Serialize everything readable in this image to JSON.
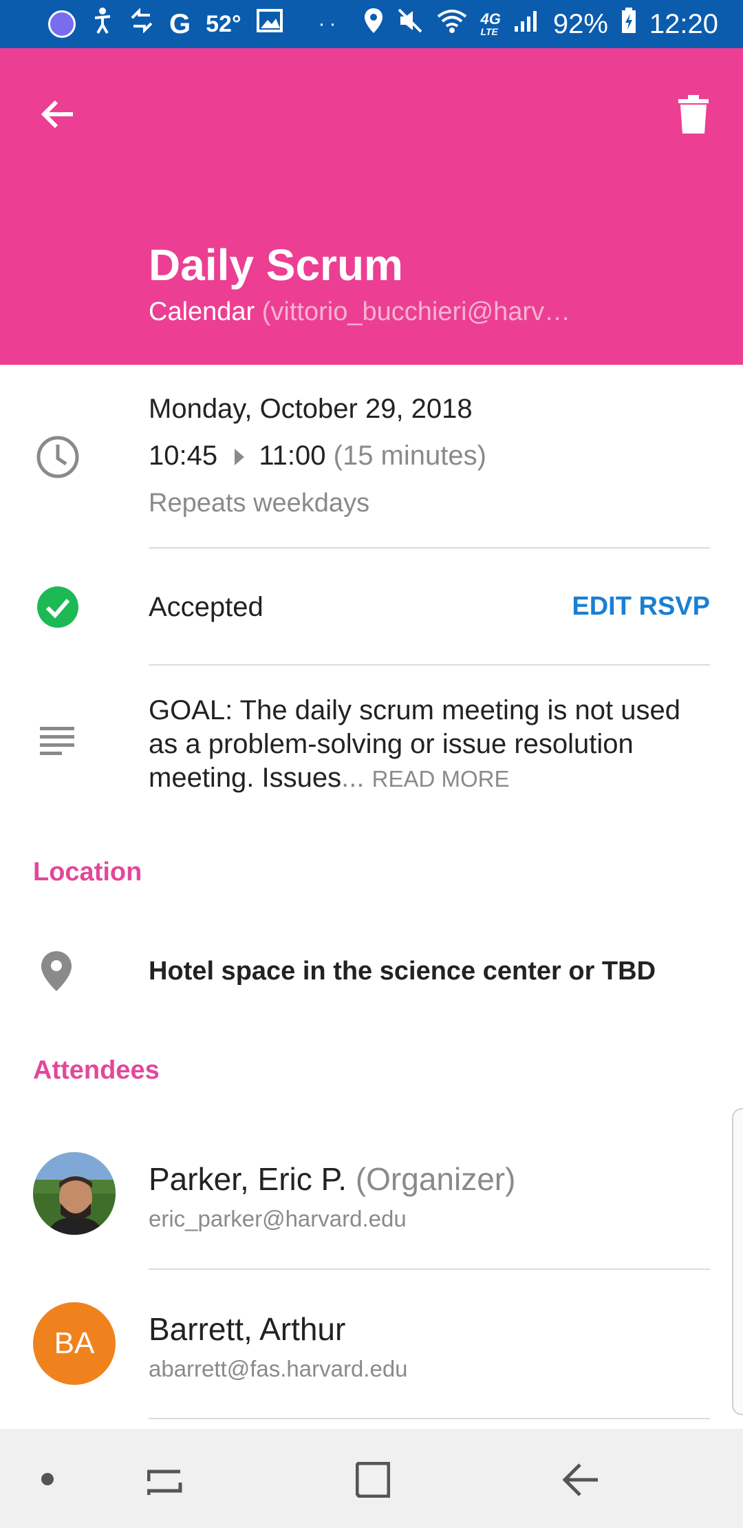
{
  "status_bar": {
    "temperature": "52°",
    "g_letter": "G",
    "network": "4G",
    "network_sub": "LTE",
    "battery": "92%",
    "time": "12:20"
  },
  "header": {
    "title": "Daily Scrum",
    "calendar_label": "Calendar",
    "calendar_account": "(vittorio_bucchieri@harv…"
  },
  "event": {
    "date": "Monday, October 29, 2018",
    "start": "10:45",
    "end": "11:00",
    "duration": "(15 minutes)",
    "recurrence": "Repeats weekdays"
  },
  "rsvp": {
    "status": "Accepted",
    "edit_label": "EDIT RSVP"
  },
  "description": {
    "text": "GOAL:   The daily scrum meeting is not used as a problem-solving or issue resolution meeting. Issues",
    "ellipsis": "...",
    "read_more": "READ MORE"
  },
  "location": {
    "section_title": "Location",
    "place": "Hotel space in the science center or TBD"
  },
  "attendees": {
    "section_title": "Attendees",
    "list": [
      {
        "name": "Parker, Eric P.",
        "role": "(Organizer)",
        "email": "eric_parker@harvard.edu",
        "initials": ""
      },
      {
        "name": "Barrett, Arthur",
        "role": "",
        "email": "abarrett@fas.harvard.edu",
        "initials": "BA"
      }
    ]
  },
  "colors": {
    "status_bar": "#0b5cad",
    "header": "#ec3f93",
    "accent_pink": "#e3479a",
    "link_blue": "#1a7fd4",
    "accepted_green": "#1db954",
    "avatar_orange": "#f0821e"
  }
}
